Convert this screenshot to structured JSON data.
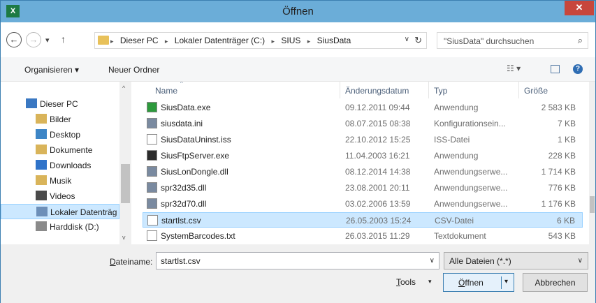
{
  "window": {
    "title": "Öffnen",
    "app_icon": "X",
    "close_glyph": "✕"
  },
  "nav": {
    "back_glyph": "←",
    "forward_glyph": "→",
    "recent_glyph": "▾",
    "up_glyph": "↑",
    "breadcrumbs": [
      "Dieser PC",
      "Lokaler Datenträger (C:)",
      "SIUS",
      "SiusData"
    ],
    "sep_glyph": "▸",
    "addr_dropdown_glyph": "∨",
    "refresh_glyph": "↻",
    "search_placeholder": "\"SiusData\" durchsuchen",
    "search_glyph": "⌕"
  },
  "toolbar": {
    "organize": "Organisieren ▾",
    "new_folder": "Neuer Ordner",
    "view_glyph": "☷ ▾",
    "help_glyph": "?"
  },
  "tree": {
    "up_glyph": "^",
    "down_glyph": "v",
    "items": [
      {
        "label": "Dieser PC",
        "icon": "computer-icon",
        "color": "#3a78c2"
      },
      {
        "label": "Bilder",
        "icon": "pictures-folder-icon",
        "color": "#d9b45a"
      },
      {
        "label": "Desktop",
        "icon": "desktop-folder-icon",
        "color": "#3d85c6"
      },
      {
        "label": "Dokumente",
        "icon": "documents-folder-icon",
        "color": "#d9b45a"
      },
      {
        "label": "Downloads",
        "icon": "downloads-folder-icon",
        "color": "#2f73c9"
      },
      {
        "label": "Musik",
        "icon": "music-folder-icon",
        "color": "#d9b45a"
      },
      {
        "label": "Videos",
        "icon": "videos-folder-icon",
        "color": "#4a4a4a"
      },
      {
        "label": "Lokaler Datenträg",
        "icon": "drive-icon",
        "color": "#6d8fb8",
        "selected": true
      },
      {
        "label": "Harddisk (D:)",
        "icon": "harddisk-icon",
        "color": "#8a8a8a"
      }
    ]
  },
  "columns": {
    "name": "Name",
    "date": "Änderungsdatum",
    "type": "Typ",
    "size": "Größe",
    "sort_glyph": "^"
  },
  "files": [
    {
      "name": "SiusData.exe",
      "date": "09.12.2011 09:44",
      "type": "Anwendung",
      "size": "2 583 KB",
      "icon": "app-icon",
      "color": "#2d9a3c"
    },
    {
      "name": "siusdata.ini",
      "date": "08.07.2015 08:38",
      "type": "Konfigurationsein...",
      "size": "7 KB",
      "icon": "settings-file-icon",
      "color": "#7a8aa0"
    },
    {
      "name": "SiusDataUninst.iss",
      "date": "22.10.2012 15:25",
      "type": "ISS-Datei",
      "size": "1 KB",
      "icon": "file-icon",
      "color": "#ffffff"
    },
    {
      "name": "SiusFtpServer.exe",
      "date": "11.04.2003 16:21",
      "type": "Anwendung",
      "size": "228 KB",
      "icon": "server-app-icon",
      "color": "#2b2b2b"
    },
    {
      "name": "SiusLonDongle.dll",
      "date": "08.12.2014 14:38",
      "type": "Anwendungserwe...",
      "size": "1 714 KB",
      "icon": "dll-icon",
      "color": "#7a8aa0"
    },
    {
      "name": "spr32d35.dll",
      "date": "23.08.2001 20:11",
      "type": "Anwendungserwe...",
      "size": "776 KB",
      "icon": "dll-icon",
      "color": "#7a8aa0"
    },
    {
      "name": "spr32d70.dll",
      "date": "03.02.2006 13:59",
      "type": "Anwendungserwe...",
      "size": "1 176 KB",
      "icon": "dll-icon",
      "color": "#7a8aa0"
    },
    {
      "name": "startlst.csv",
      "date": "26.05.2003 15:24",
      "type": "CSV-Datei",
      "size": "6 KB",
      "icon": "csv-file-icon",
      "color": "#ffffff",
      "selected": true
    },
    {
      "name": "SystemBarcodes.txt",
      "date": "26.03.2015 11:29",
      "type": "Textdokument",
      "size": "543 KB",
      "icon": "text-file-icon",
      "color": "#ffffff"
    }
  ],
  "bottom": {
    "filename_label_prefix": "D",
    "filename_label_rest": "ateiname:",
    "filename_value": "startlst.csv",
    "filetype_value": "Alle Dateien (*.*)",
    "dropdown_glyph": "∨",
    "tools_prefix": "T",
    "tools_rest": "ools",
    "tools_glyph": "▾",
    "open_prefix": "Ö",
    "open_rest": "ffnen",
    "open_split_glyph": "▾",
    "cancel": "Abbrechen"
  },
  "colors": {
    "selection": "#cce8ff",
    "selection_border": "#99d1ff",
    "titlebar": "#6badd8"
  }
}
